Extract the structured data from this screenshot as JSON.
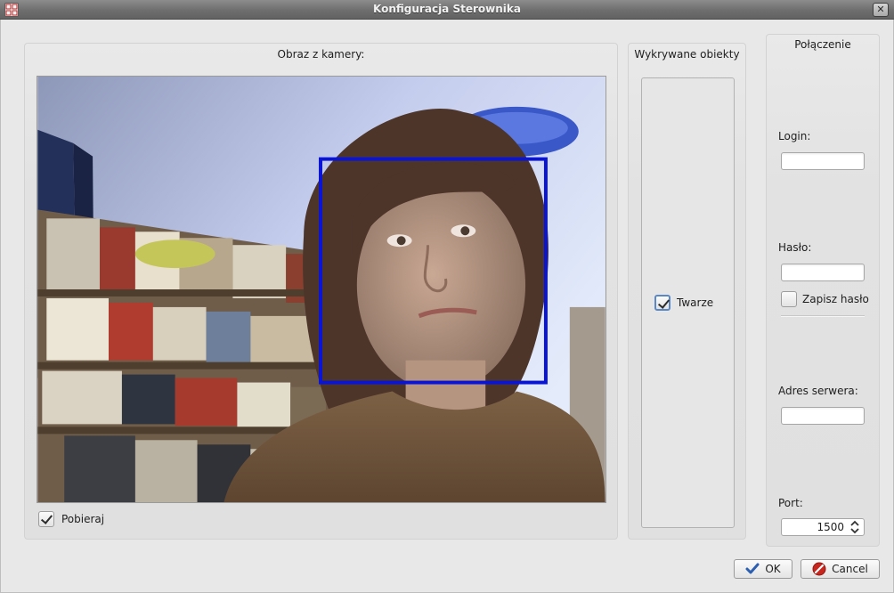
{
  "window": {
    "title": "Konfiguracja Sterownika",
    "close_glyph": "✕"
  },
  "camera": {
    "title": "Obraz z kamery:",
    "capture_label": "Pobieraj",
    "capture_checked": true,
    "face_box_color": "#0a14d4"
  },
  "objects": {
    "title": "Wykrywane obiekty",
    "items": [
      {
        "label": "Twarze",
        "checked": true
      }
    ]
  },
  "connection": {
    "title": "Połączenie",
    "login_label": "Login:",
    "login_value": "",
    "password_label": "Hasło:",
    "password_value": "",
    "save_password_label": "Zapisz hasło",
    "save_password_checked": false,
    "server_label": "Adres serwera:",
    "server_value": "",
    "port_label": "Port:",
    "port_value": "1500"
  },
  "buttons": {
    "ok_label": "OK",
    "cancel_label": "Cancel"
  },
  "icons": {
    "app": "app-icon",
    "close": "close-icon",
    "ok": "checkmark-icon",
    "cancel": "cancel-icon",
    "spin": "spin-arrows-icon"
  }
}
